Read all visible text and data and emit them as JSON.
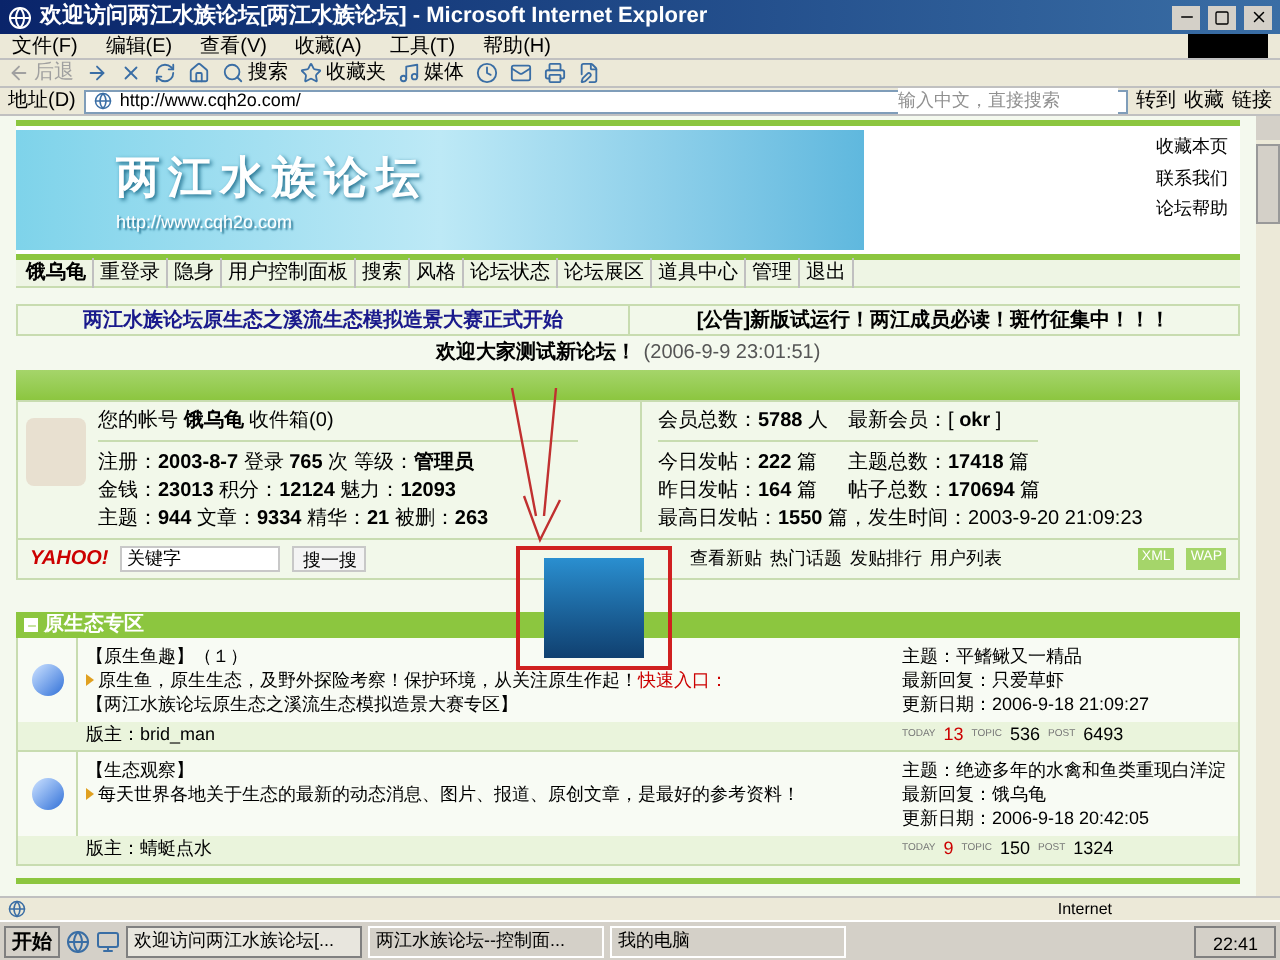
{
  "window": {
    "title": "欢迎访问两江水族论坛[两江水族论坛] - Microsoft Internet Explorer"
  },
  "menu": [
    "文件(F)",
    "编辑(E)",
    "查看(V)",
    "收藏(A)",
    "工具(T)",
    "帮助(H)"
  ],
  "toolbar": [
    {
      "kind": "back",
      "label": "后退",
      "disabled": true
    },
    {
      "kind": "forward",
      "disabled": false
    },
    {
      "kind": "stop",
      "disabled": false
    },
    {
      "kind": "refresh",
      "disabled": false
    },
    {
      "kind": "home",
      "disabled": false
    },
    {
      "kind": "search",
      "label": "搜索",
      "disabled": false
    },
    {
      "kind": "favorites",
      "label": "收藏夹",
      "disabled": false
    },
    {
      "kind": "media",
      "label": "媒体",
      "disabled": false
    },
    {
      "kind": "history",
      "disabled": false
    },
    {
      "kind": "mail",
      "disabled": false
    },
    {
      "kind": "print",
      "disabled": false
    },
    {
      "kind": "edit",
      "disabled": false
    }
  ],
  "address": {
    "label": "地址(D)",
    "url": "http://www.cqh2o.com/",
    "search_placeholder": "输入中文，直接搜索",
    "go": "转到",
    "favorites": "收藏",
    "links": "链接"
  },
  "banner": {
    "title": "两江水族论坛",
    "url": "http://www.cqh2o.com",
    "links": [
      "收藏本页",
      "联系我们",
      "论坛帮助"
    ]
  },
  "nav": [
    {
      "label": "饿乌龟",
      "bold": true
    },
    {
      "label": "重登录",
      "bold": false
    },
    {
      "label": "隐身",
      "bold": false
    },
    {
      "label": "用户控制面板",
      "bold": false
    },
    {
      "label": "搜索",
      "bold": false
    },
    {
      "label": "风格",
      "bold": false
    },
    {
      "label": "论坛状态",
      "bold": false
    },
    {
      "label": "论坛展区",
      "bold": false
    },
    {
      "label": "道具中心",
      "bold": false
    },
    {
      "label": "管理",
      "bold": false
    },
    {
      "label": "退出",
      "bold": false
    }
  ],
  "announcements": [
    "两江水族论坛原生态之溪流生态模拟造景大赛正式开始",
    "[公告]新版试运行！两江成员必读！斑竹征集中！！！"
  ],
  "welcome": {
    "text": "欢迎大家测试新论坛！",
    "time": "(2006-9-9 23:01:51)"
  },
  "user": {
    "account": "您的帐号 **饿乌龟** 收件箱(0)",
    "lines": [
      "注册：**2003-8-7** 登录 **765** 次 等级：**管理员**",
      "金钱：**23013** 积分：**12124** 魅力：**12093**",
      "主题：**944** 文章：**9334** 精华：**21** 被删：**263**"
    ]
  },
  "stats": [
    [
      "会员总数：**5788** 人",
      "最新会员：[ **okr** ]"
    ],
    [
      "今日发帖：**222** 篇",
      "主题总数：**17418** 篇"
    ],
    [
      "昨日发帖：**164** 篇",
      "帖子总数：**170694** 篇"
    ],
    [
      "最高日发帖：**1550** 篇，发生时间：2003-9-20 21:09:23"
    ]
  ],
  "search": {
    "logo": "YAHOO!",
    "placeholder": "关键字",
    "button": "搜一搜"
  },
  "quick_links": [
    "查看新贴",
    "热门话题",
    "发贴排行",
    "用户列表"
  ],
  "feeds": [
    "XML",
    "WAP"
  ],
  "section": {
    "title": "原生态专区",
    "expanded": true
  },
  "forums": [
    {
      "name": "【原生鱼趣】（１）",
      "description": "原生鱼，原生生态，及野外探险考察！保护环境，从关注原生作起！",
      "quick_label": "快速入口：",
      "quick_link": "【两江水族论坛原生态之溪流生态模拟造景大赛专区】",
      "topic": "主题：平鳍鳅又一精品",
      "reply": "最新回复：只爱草虾",
      "date": "更新日期：2006-9-18 21:09:27",
      "moderator": "版主：brid_man",
      "labels": [
        "TODAY",
        "TOPIC",
        "POST"
      ],
      "today": "13",
      "topics": "536",
      "posts": "6493"
    },
    {
      "name": "【生态观察】",
      "description": "每天世界各地关于生态的最新的动态消息、图片、报道、原创文章，是最好的参考资料！",
      "topic": "主题：绝迹多年的水禽和鱼类重现白洋淀",
      "reply": "最新回复：饿乌龟",
      "date": "更新日期：2006-9-18 20:42:05",
      "moderator": "版主：蜻蜓点水",
      "labels": [
        "TODAY",
        "TOPIC",
        "POST"
      ],
      "today": "9",
      "topics": "150",
      "posts": "1324"
    }
  ],
  "status": {
    "zone": "Internet"
  },
  "taskbar": {
    "start": "开始",
    "tasks": [
      {
        "label": "欢迎访问两江水族论坛[...",
        "selected": true
      },
      {
        "label": "两江水族论坛--控制面...",
        "selected": false
      },
      {
        "label": "我的电脑",
        "selected": false
      }
    ],
    "clock": "22:41"
  }
}
